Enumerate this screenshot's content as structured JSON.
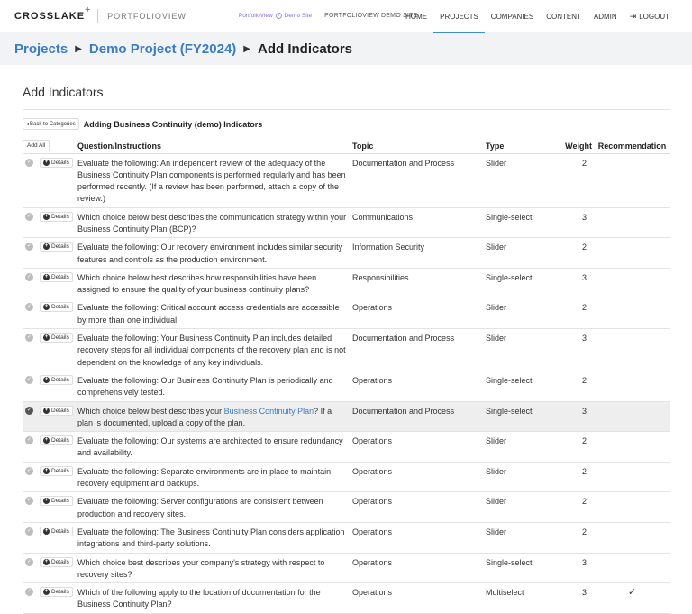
{
  "nav": {
    "logo": "CROSSLAKE",
    "logo_plus": "+",
    "logo_sub": "PORTFOLIOVIEW",
    "demo_site": "PortfolioView",
    "demo_site_suffix": "Demo Site",
    "demo_label": "PORTFOLIOVIEW DEMO SITE",
    "items": [
      "HOME",
      "PROJECTS",
      "COMPANIES",
      "CONTENT",
      "ADMIN"
    ],
    "logout": "LOGOUT",
    "active_item": "PROJECTS"
  },
  "breadcrumb": {
    "projects": "Projects",
    "project": "Demo Project (FY2024)",
    "current": "Add Indicators"
  },
  "page_title": "Add Indicators",
  "back_label": "Back to Categories",
  "sub_title": "Adding Business Continuity (demo) Indicators",
  "table": {
    "add_all": "Add All",
    "headers": {
      "question": "Question/Instructions",
      "topic": "Topic",
      "type": "Type",
      "weight": "Weight",
      "recommendation": "Recommendation"
    },
    "details_label": "Details",
    "rows": [
      {
        "q": "Evaluate the following: An independent review of the adequacy of the Business Continuity Plan components is performed regularly and has been performed recently. (If a review has been performed, attach a copy of the review.)",
        "topic": "Documentation and Process",
        "type": "Slider",
        "weight": "2",
        "rec": ""
      },
      {
        "q": "Which choice below best describes the communication strategy within your Business Continuity Plan (BCP)?",
        "topic": "Communications",
        "type": "Single-select",
        "weight": "3",
        "rec": ""
      },
      {
        "q": "Evaluate the following: Our recovery environment includes similar security features and controls as the production environment.",
        "topic": "Information Security",
        "type": "Slider",
        "weight": "2",
        "rec": ""
      },
      {
        "q": "Which choice below best describes how responsibilities have been assigned to ensure the quality of your business continuity plans?",
        "topic": "Responsibilities",
        "type": "Single-select",
        "weight": "3",
        "rec": ""
      },
      {
        "q": "Evaluate the following: Critical account access credentials are accessible by more than one individual.",
        "topic": "Operations",
        "type": "Slider",
        "weight": "2",
        "rec": ""
      },
      {
        "q": "Evaluate the following: Your Business Continuity Plan includes detailed recovery steps for all individual components of the recovery plan and is not dependent on the knowledge of any key individuals.",
        "topic": "Documentation and Process",
        "type": "Slider",
        "weight": "3",
        "rec": ""
      },
      {
        "q": "Evaluate the following: Our Business Continuity Plan is periodically and comprehensively tested.",
        "topic": "Operations",
        "type": "Single-select",
        "weight": "2",
        "rec": ""
      },
      {
        "q_pre": "Which choice below best describes your ",
        "q_link": "Business Continuity Plan",
        "q_post": "? If a plan is documented, upload a copy of the plan.",
        "topic": "Documentation and Process",
        "type": "Single-select",
        "weight": "3",
        "rec": "",
        "highlight": true
      },
      {
        "q": "Evaluate the following: Our systems are architected to ensure redundancy and availability.",
        "topic": "Operations",
        "type": "Slider",
        "weight": "2",
        "rec": ""
      },
      {
        "q": "Evaluate the following: Separate environments are in place to maintain recovery equipment and backups.",
        "topic": "Operations",
        "type": "Slider",
        "weight": "2",
        "rec": ""
      },
      {
        "q": "Evaluate the following: Server configurations are consistent between production and recovery sites.",
        "topic": "Operations",
        "type": "Slider",
        "weight": "2",
        "rec": ""
      },
      {
        "q": "Evaluate the following: The Business Continuity Plan considers application integrations and third-party solutions.",
        "topic": "Operations",
        "type": "Slider",
        "weight": "2",
        "rec": ""
      },
      {
        "q": "Which choice best describes your company's strategy with respect to recovery sites?",
        "topic": "Operations",
        "type": "Single-select",
        "weight": "3",
        "rec": ""
      },
      {
        "q": "Which of the following apply to the location of documentation for the Business Continuity Plan?",
        "topic": "Operations",
        "type": "Multiselect",
        "weight": "3",
        "rec": "✓"
      }
    ]
  }
}
